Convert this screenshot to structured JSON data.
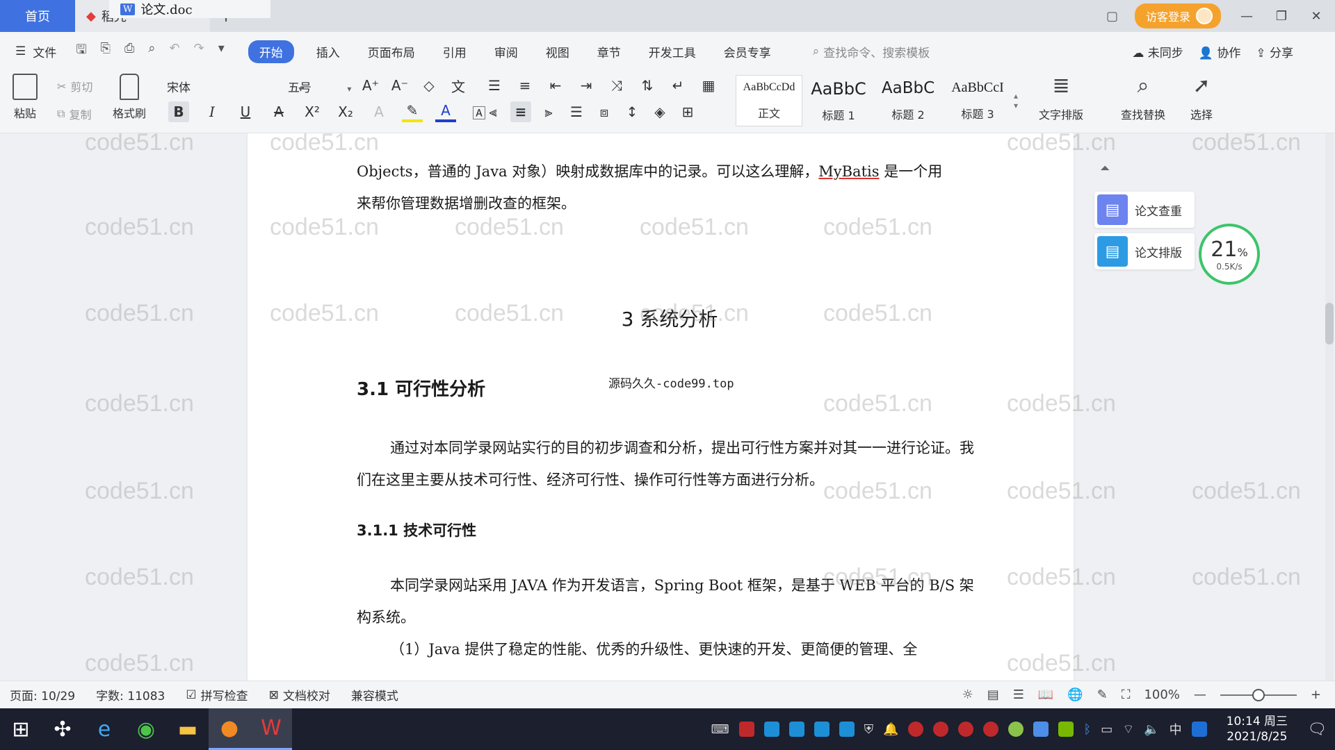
{
  "titlebar": {
    "tabs": [
      {
        "label": "首页"
      },
      {
        "label": "稻壳"
      },
      {
        "label": "论文.doc"
      }
    ],
    "guest_login": "访客登录"
  },
  "menubar": {
    "file": "文件",
    "items": [
      "开始",
      "插入",
      "页面布局",
      "引用",
      "审阅",
      "视图",
      "章节",
      "开发工具",
      "会员专享"
    ],
    "search_placeholder": "查找命令、搜索模板",
    "sync": "未同步",
    "collab": "协作",
    "share": "分享"
  },
  "ribbon": {
    "paste": "粘贴",
    "cut": "剪切",
    "copy": "复制",
    "format_painter": "格式刷",
    "font_name": "宋体",
    "font_size": "五号",
    "styles": [
      {
        "sample": "AaBbCcDd",
        "name": "正文"
      },
      {
        "sample": "AaBbC",
        "name": "标题 1"
      },
      {
        "sample": "AaBbC",
        "name": "标题 2"
      },
      {
        "sample": "AaBbCcI",
        "name": "标题 3"
      }
    ],
    "text_layout": "文字排版",
    "find_replace": "查找替换",
    "select": "选择"
  },
  "document": {
    "para1_line1_a": "Objects，普通的 Java 对象）映射成数据库中的记录。可以这么理解，",
    "para1_mybatis": "MyBatis",
    "para1_line1_b": " 是一个用",
    "para1_line2": "来帮你管理数据增删改查的框架。",
    "chapter_title": "3 系统分析",
    "section_title": "3.1 可行性分析",
    "source_tag": "源码久久-code99.top",
    "para2": "通过对本同学录网站实行的目的初步调查和分析，提出可行性方案并对其一一进行论证。我们在这里主要从技术可行性、经济可行性、操作可行性等方面进行分析。",
    "subsection_title": "3.1.1 技术可行性",
    "para3": "本同学录网站采用 JAVA 作为开发语言，Spring Boot 框架，是基于 WEB 平台的 B/S 架构系统。",
    "para4": "（1）Java 提供了稳定的性能、优秀的升级性、更快速的开发、更简便的管理、全"
  },
  "watermark_text": "code51.cn",
  "side_panel": {
    "check": "论文查重",
    "layout": "论文排版",
    "speed_percent": "21",
    "speed_unit": "%",
    "speed_rate": "0.5K/s"
  },
  "statusbar": {
    "page": "页面: 10/29",
    "words": "字数: 11083",
    "spell": "拼写检查",
    "proof": "文档校对",
    "compat": "兼容模式",
    "zoom": "100%",
    "zoom_level": 0.5
  },
  "taskbar": {
    "time": "10:14 周三",
    "date": "2021/8/25",
    "ime": "中"
  },
  "colors": {
    "accent": "#3f72e0",
    "guest_btn": "#f5a22d",
    "speed_ring": "#3cc46a"
  }
}
